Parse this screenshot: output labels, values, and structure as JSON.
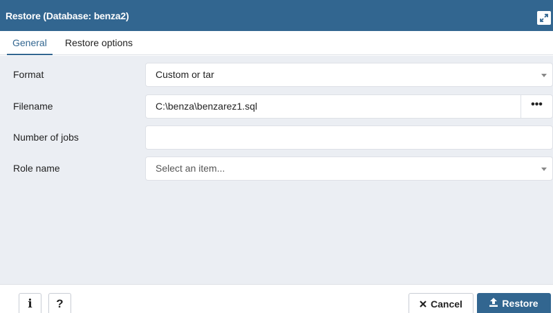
{
  "dialog": {
    "title": "Restore (Database: benza2)",
    "maximize_icon": "expand-icon"
  },
  "tabs": [
    {
      "label": "General",
      "active": true
    },
    {
      "label": "Restore options",
      "active": false
    }
  ],
  "form": {
    "format": {
      "label": "Format",
      "value": "Custom or tar"
    },
    "filename": {
      "label": "Filename",
      "value": "C:\\benza\\benzarez1.sql",
      "browse_label": "•••"
    },
    "jobs": {
      "label": "Number of jobs",
      "value": ""
    },
    "role": {
      "label": "Role name",
      "placeholder": "Select an item..."
    }
  },
  "footer": {
    "info_label": "i",
    "help_label": "?",
    "cancel_label": "Cancel",
    "restore_label": "Restore"
  },
  "colors": {
    "accent": "#326690",
    "content_bg": "#ebeef3",
    "border": "#dde0e6"
  }
}
